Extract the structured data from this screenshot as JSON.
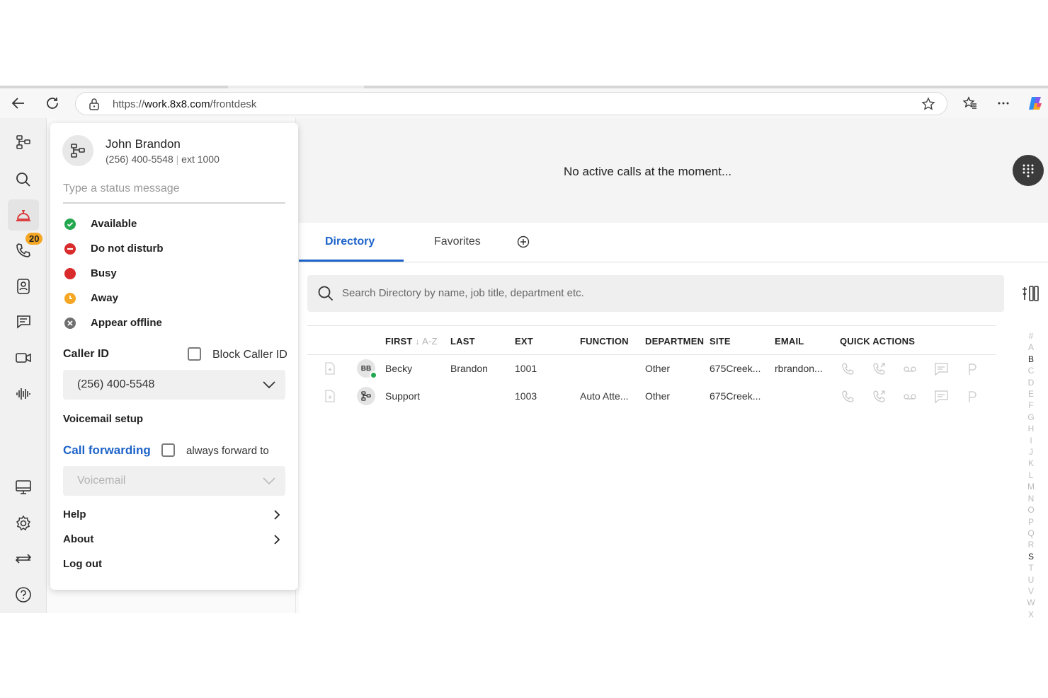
{
  "browser": {
    "url_scheme": "https://",
    "url_host": "work.8x8.com",
    "url_path": "/frontdesk"
  },
  "rail": {
    "items": [
      {
        "icon": "sitemap-icon"
      },
      {
        "icon": "search-icon"
      },
      {
        "icon": "bell-icon",
        "active": true
      },
      {
        "icon": "phone-icon",
        "badge": "20"
      },
      {
        "icon": "contacts-icon"
      },
      {
        "icon": "chat-icon"
      },
      {
        "icon": "video-icon"
      },
      {
        "icon": "voice-icon"
      },
      {
        "icon": "monitor-icon"
      },
      {
        "icon": "gear-icon"
      },
      {
        "icon": "transfer-icon"
      },
      {
        "icon": "help-icon"
      }
    ]
  },
  "calls": {
    "message": "No active calls at the moment..."
  },
  "tabs": {
    "directory": "Directory",
    "favorites": "Favorites"
  },
  "search": {
    "placeholder": "Search Directory by name, job title, department etc."
  },
  "table": {
    "headers": {
      "first": "FIRST",
      "sort": "A-Z",
      "last": "LAST",
      "ext": "EXT",
      "function": "FUNCTION",
      "department": "DEPARTMEN",
      "site": "SITE",
      "email": "EMAIL",
      "quick_actions": "QUICK ACTIONS"
    },
    "rows": [
      {
        "initials": "BB",
        "first": "Becky",
        "last": "Brandon",
        "ext": "1001",
        "function": "",
        "department": "Other",
        "site": "675Creek...",
        "email": "rbrandon..."
      },
      {
        "initials": "",
        "first": "Support",
        "last": "",
        "ext": "1003",
        "function": "Auto Atte...",
        "department": "Other",
        "site": "675Creek...",
        "email": ""
      }
    ]
  },
  "alphabet": [
    "#",
    "A",
    "B",
    "C",
    "D",
    "E",
    "F",
    "G",
    "H",
    "I",
    "J",
    "K",
    "L",
    "M",
    "N",
    "O",
    "P",
    "Q",
    "R",
    "S",
    "T",
    "U",
    "V",
    "W",
    "X"
  ],
  "alphabet_active": [
    "B",
    "S"
  ],
  "profile": {
    "name": "John Brandon",
    "number": "(256) 400-5548",
    "ext": "ext 1000",
    "status_placeholder": "Type a status message",
    "presence": [
      {
        "label": "Available",
        "color": "#23a74f"
      },
      {
        "label": "Do not disturb",
        "color": "#d92b2b"
      },
      {
        "label": "Busy",
        "color": "#d92b2b"
      },
      {
        "label": "Away",
        "color": "#f5a623"
      },
      {
        "label": "Appear offline",
        "color": "#6f6f6f"
      }
    ],
    "caller_id_label": "Caller ID",
    "block_caller_id": "Block Caller ID",
    "caller_id_value": "(256) 400-5548",
    "voicemail_setup": "Voicemail setup",
    "call_forwarding": "Call forwarding",
    "always_forward_to": "always forward to",
    "forward_target": "Voicemail",
    "help": "Help",
    "about": "About",
    "logout": "Log out"
  }
}
